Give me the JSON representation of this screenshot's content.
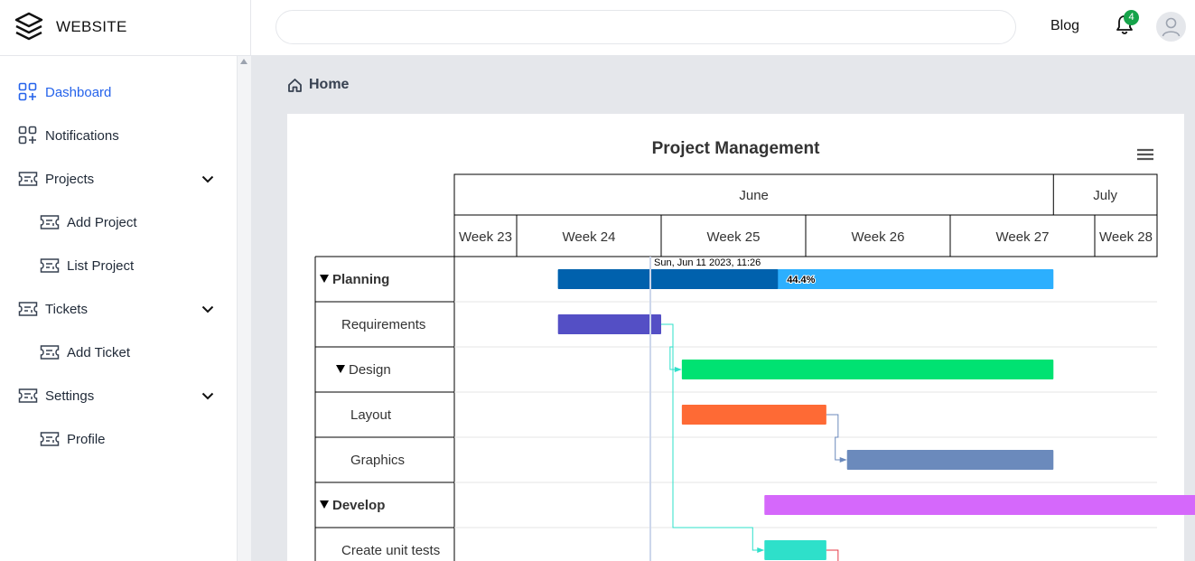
{
  "brand": {
    "name": "WEBSITE"
  },
  "header": {
    "search_placeholder": "",
    "blog_label": "Blog",
    "notification_count": "4"
  },
  "sidebar": {
    "items": [
      {
        "label": "Dashboard",
        "icon": "dashboard-icon",
        "active": true
      },
      {
        "label": "Notifications",
        "icon": "dashboard-icon"
      },
      {
        "label": "Projects",
        "icon": "ticket-icon",
        "expandable": true
      },
      {
        "label": "Add Project",
        "icon": "ticket-icon",
        "child": true
      },
      {
        "label": "List Project",
        "icon": "ticket-icon",
        "child": true
      },
      {
        "label": "Tickets",
        "icon": "ticket-icon",
        "expandable": true
      },
      {
        "label": "Add Ticket",
        "icon": "ticket-icon",
        "child": true
      },
      {
        "label": "Settings",
        "icon": "ticket-icon",
        "expandable": true
      },
      {
        "label": "Profile",
        "icon": "ticket-icon",
        "child": true
      }
    ]
  },
  "breadcrumb": {
    "label": "Home"
  },
  "colors": {
    "accent": "#2563eb",
    "badge": "#16a34a"
  },
  "chart_data": {
    "type": "gantt",
    "title": "Project Management",
    "months": [
      {
        "label": "June"
      },
      {
        "label": "July"
      }
    ],
    "weeks": [
      "Week 23",
      "Week 24",
      "Week 25",
      "Week 26",
      "Week 27",
      "Week 28"
    ],
    "current_time_label": "Sun, Jun 11 2023, 11:26",
    "tasks": [
      {
        "name": "Planning",
        "level": 0,
        "group": true,
        "start": "2023-06-07",
        "end": "2023-07-01",
        "completed": 0.444,
        "completed_label": "44.4%",
        "color": "#0061ad",
        "fill_color": "#2caffe"
      },
      {
        "name": "Requirements",
        "level": 1,
        "start": "2023-06-07",
        "end": "2023-06-12",
        "color": "#544fc5"
      },
      {
        "name": "Design",
        "level": 1,
        "group": true,
        "start": "2023-06-13",
        "end": "2023-07-01",
        "color": "#00e272"
      },
      {
        "name": "Layout",
        "level": 2,
        "start": "2023-06-13",
        "end": "2023-06-20",
        "color": "#fe6a35"
      },
      {
        "name": "Graphics",
        "level": 2,
        "start": "2023-06-21",
        "end": "2023-07-01",
        "color": "#6b8abc"
      },
      {
        "name": "Develop",
        "level": 0,
        "group": true,
        "start": "2023-06-17",
        "end": "2023-07-11",
        "color": "#d568fb"
      },
      {
        "name": "Create unit tests",
        "level": 1,
        "start": "2023-06-17",
        "end": "2023-06-20",
        "color": "#2ee0ca"
      }
    ],
    "dependencies": [
      {
        "from": "Requirements",
        "to": "Design",
        "color": "#2ee0ca"
      },
      {
        "from": "Requirements",
        "to": "Create unit tests",
        "color": "#2ee0ca"
      },
      {
        "from": "Layout",
        "to": "Graphics",
        "color": "#6b8abc"
      }
    ]
  }
}
